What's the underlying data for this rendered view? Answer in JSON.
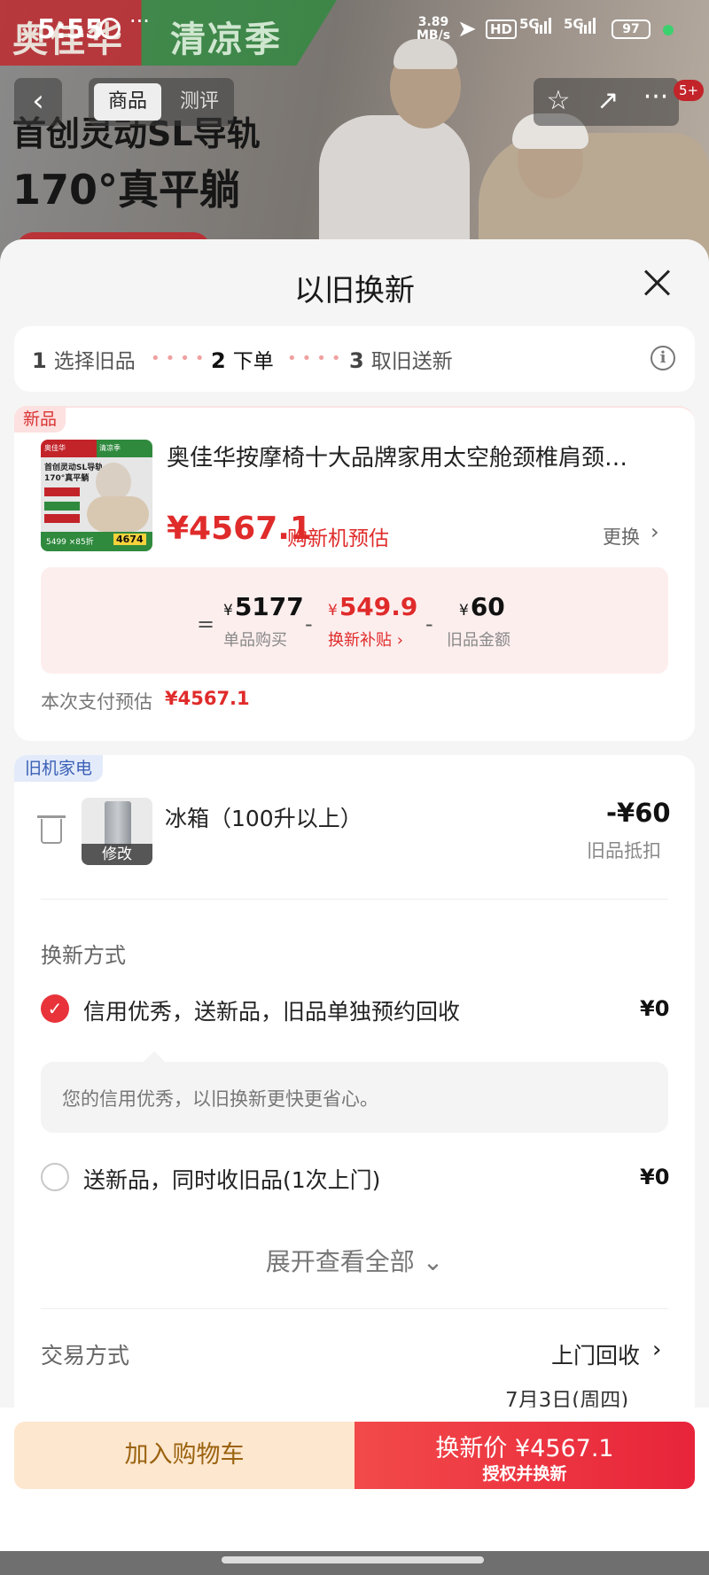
{
  "status_bar": {
    "time": "5:55",
    "dots": "···",
    "net_speed_value": "3.89",
    "net_speed_unit": "MB/s",
    "hd": "HD",
    "signal_1": "5G",
    "signal_2": "5G",
    "battery": "97"
  },
  "backdrop": {
    "brand_1": "奥佳华",
    "brand_2": "清凉季",
    "promo_line_1": "首创灵动SL导轨",
    "promo_line_2": "170°真平躺"
  },
  "nav": {
    "back_icon": "‹",
    "tabs": [
      {
        "label": "商品",
        "active": true
      },
      {
        "label": "测评",
        "active": false
      }
    ],
    "star_icon": "☆",
    "share_icon": "↗",
    "more_icon": "···",
    "message_badge": "5+"
  },
  "sheet": {
    "title": "以旧换新"
  },
  "steps": [
    {
      "num": "1",
      "label": "选择旧品"
    },
    {
      "num": "2",
      "label": "下单"
    },
    {
      "num": "3",
      "label": "取旧送新"
    }
  ],
  "new_product": {
    "tag": "新品",
    "name": "奥佳华按摩椅十大品牌家用太空舱颈椎肩颈…",
    "thumb": {
      "brand_1": "奥佳华",
      "brand_2": "清凉季",
      "headline_1": "首创灵动SL导轨",
      "headline_2": "170°真平躺",
      "price_left": "5499 ×85折",
      "price_right": "4674"
    },
    "price": "¥4567.1",
    "price_label": "购新机预估",
    "replace_label": "更换",
    "calc": {
      "equals": "=",
      "minus": "-",
      "items": [
        {
          "currency": "¥",
          "value": "5177",
          "label": "单品购买"
        },
        {
          "currency": "¥",
          "value": "549.9",
          "label": "换新补贴 ›"
        },
        {
          "currency": "¥",
          "value": "60",
          "label": "旧品金额"
        }
      ]
    },
    "pay_estimate_label": "本次支付预估",
    "pay_estimate_value": "¥4567.1"
  },
  "old_appliance": {
    "tag": "旧机家电",
    "name": "冰箱（100升以上）",
    "edit_label": "修改",
    "deduct_value": "-¥60",
    "deduct_label": "旧品抵扣"
  },
  "trade_method": {
    "title": "换新方式",
    "options": [
      {
        "label": "信用优秀，送新品，旧品单独预约回收",
        "price": "¥0",
        "selected": true
      },
      {
        "label": "送新品，同时收旧品(1次上门)",
        "price": "¥0",
        "selected": false
      }
    ],
    "note": "您的信用优秀，以旧换新更快更省心。",
    "expand_label": "展开查看全部"
  },
  "transaction": {
    "title": "交易方式",
    "value": "上门回收",
    "date": "7月3日(周四)"
  },
  "bottom_bar": {
    "cart_label": "加入购物车",
    "trade_main": "换新价 ¥4567.1",
    "trade_sub": "授权并换新"
  },
  "colors": {
    "accent_red": "#e02b2b",
    "cart_bg": "#fde7cf",
    "cart_text": "#9b6310",
    "old_tag_blue": "#3a5fb5"
  }
}
